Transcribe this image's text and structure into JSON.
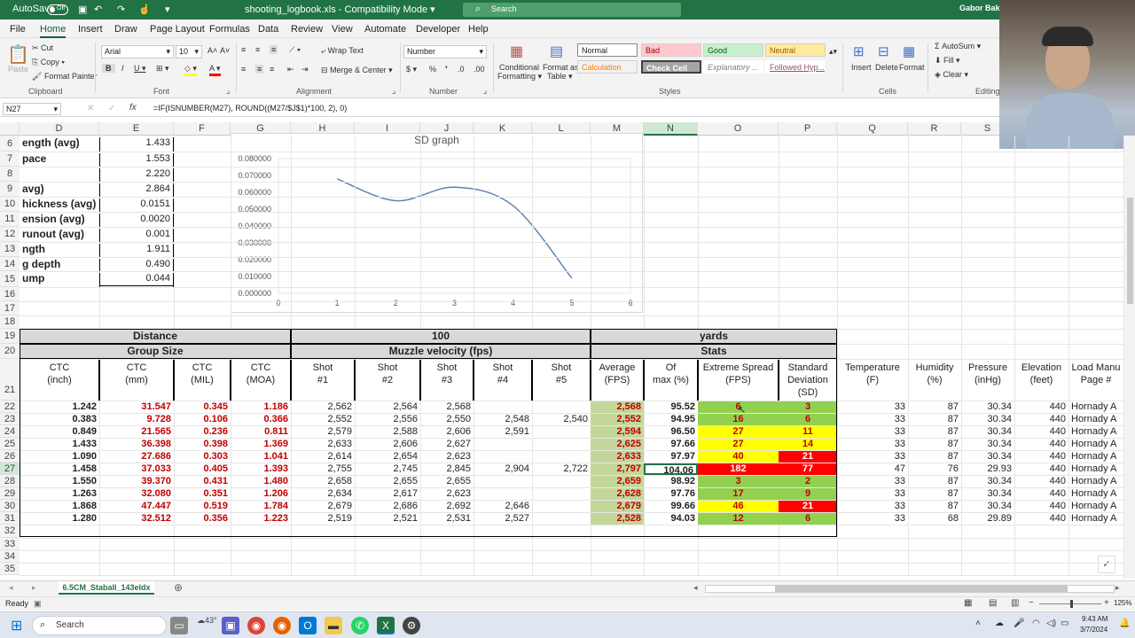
{
  "title": {
    "autosave": "AutoSave",
    "autosave_state": "Off",
    "filename": "shooting_logbook.xls",
    "mode": "Compatibility Mode",
    "search": "Search",
    "user": "Gabor Bakos"
  },
  "menu": [
    "File",
    "Home",
    "Insert",
    "Draw",
    "Page Layout",
    "Formulas",
    "Data",
    "Review",
    "View",
    "Automate",
    "Developer",
    "Help"
  ],
  "ribbon": {
    "cut": "Cut",
    "copy": "Copy",
    "format_painter": "Format Painter",
    "paste": "Paste",
    "clipboard": "Clipboard",
    "font_name": "Arial",
    "font_size": "10",
    "font": "Font",
    "wrap_text": "Wrap Text",
    "merge_center": "Merge & Center",
    "alignment": "Alignment",
    "number_format": "Number",
    "number": "Number",
    "conditional": "Conditional",
    "formatting": "Formatting",
    "format_as": "Format as",
    "table": "Table",
    "styles_label": "Styles",
    "styles": {
      "normal": "Normal",
      "bad": "Bad",
      "good": "Good",
      "neutral": "Neutral",
      "calculation": "Calculation",
      "check_cell": "Check Cell",
      "explanatory": "Explanatory ...",
      "followed": "Followed Hyp..."
    },
    "insert": "Insert",
    "delete": "Delete",
    "format": "Format",
    "cells": "Cells",
    "autosum": "AutoSum",
    "fill": "Fill",
    "clear": "Clear",
    "editing": "Editing"
  },
  "formula": {
    "namebox": "N27",
    "fx": "fx",
    "text": "=IF(ISNUMBER(M27), ROUND((M27/$J$1)*100, 2), 0)"
  },
  "columns": [
    "D",
    "E",
    "F",
    "G",
    "H",
    "I",
    "J",
    "K",
    "L",
    "M",
    "N",
    "O",
    "P",
    "Q",
    "R",
    "S"
  ],
  "rows": [
    "6",
    "7",
    "8",
    "9",
    "10",
    "11",
    "12",
    "13",
    "14",
    "15",
    "16",
    "17",
    "18",
    "19",
    "20",
    "21",
    "22",
    "23",
    "24",
    "25",
    "26",
    "27",
    "28",
    "29",
    "30",
    "31",
    "32",
    "33",
    "34",
    "35"
  ],
  "top_table": [
    {
      "label": "ength (avg)",
      "value": "1.433"
    },
    {
      "label": "pace",
      "value": "1.553"
    },
    {
      "label": "",
      "value": "2.220"
    },
    {
      "label": "avg)",
      "value": "2.864"
    },
    {
      "label": "hickness (avg)",
      "value": "0.0151"
    },
    {
      "label": "ension (avg)",
      "value": "0.0020"
    },
    {
      "label": "runout (avg)",
      "value": "0.001"
    },
    {
      "label": "ngth",
      "value": "1.911"
    },
    {
      "label": "g depth",
      "value": "0.490"
    },
    {
      "label": "ump",
      "value": "0.044"
    }
  ],
  "chart_data": {
    "type": "line",
    "title": "SD graph",
    "x": [
      1,
      2,
      3,
      4,
      5
    ],
    "values": [
      0.068,
      0.055,
      0.063,
      0.052,
      0.009
    ],
    "xlim": [
      0,
      6
    ],
    "ylim": [
      0,
      0.08
    ],
    "xticks": [
      "0",
      "1",
      "2",
      "3",
      "4",
      "5",
      "6"
    ],
    "yticks": [
      "0.000000",
      "0.010000",
      "0.020000",
      "0.030000",
      "0.040000",
      "0.050000",
      "0.060000",
      "0.070000",
      "0.080000"
    ],
    "color": "#5b84b1"
  },
  "headers": {
    "distance": "Distance",
    "hundred": "100",
    "yards": "yards",
    "group_size": "Group Size",
    "muzzle": "Muzzle velocity (fps)",
    "stats": "Stats",
    "cols": [
      [
        "CTC",
        "(inch)"
      ],
      [
        "CTC",
        "(mm)"
      ],
      [
        "CTC",
        "(MIL)"
      ],
      [
        "CTC",
        "(MOA)"
      ],
      [
        "Shot",
        "#1"
      ],
      [
        "Shot",
        "#2"
      ],
      [
        "Shot",
        "#3"
      ],
      [
        "Shot",
        "#4"
      ],
      [
        "Shot",
        "#5"
      ],
      [
        "Average",
        "(FPS)"
      ],
      [
        "Of",
        "max (%)"
      ],
      [
        "Extreme Spread",
        "(FPS)"
      ],
      [
        "Standard",
        "Deviation",
        "(SD)"
      ],
      [
        "Temperature",
        "(F)"
      ],
      [
        "Humidity",
        "(%)"
      ],
      [
        "Pressure",
        "(inHg)"
      ],
      [
        "Elevation",
        "(feet)"
      ],
      [
        "Load Manu",
        "Page #"
      ]
    ]
  },
  "data": [
    [
      "1.242",
      "31.547",
      "0.345",
      "1.186",
      "2,562",
      "2,564",
      "2,568",
      "",
      "",
      "2,568",
      "95.52",
      "6",
      "3",
      "33",
      "87",
      "30.34",
      "440",
      "Hornady A"
    ],
    [
      "0.383",
      "9.728",
      "0.106",
      "0.366",
      "2,552",
      "2,556",
      "2,550",
      "2,548",
      "2,540",
      "2,552",
      "94.95",
      "16",
      "6",
      "33",
      "87",
      "30.34",
      "440",
      "Hornady A"
    ],
    [
      "0.849",
      "21.565",
      "0.236",
      "0.811",
      "2,579",
      "2,588",
      "2,606",
      "2,591",
      "",
      "2,594",
      "96.50",
      "27",
      "11",
      "33",
      "87",
      "30.34",
      "440",
      "Hornady A"
    ],
    [
      "1.433",
      "36.398",
      "0.398",
      "1.369",
      "2,633",
      "2,606",
      "2,627",
      "",
      "",
      "2,625",
      "97.66",
      "27",
      "14",
      "33",
      "87",
      "30.34",
      "440",
      "Hornady A"
    ],
    [
      "1.090",
      "27.686",
      "0.303",
      "1.041",
      "2,614",
      "2,654",
      "2,623",
      "",
      "",
      "2,633",
      "97.97",
      "40",
      "21",
      "33",
      "87",
      "30.34",
      "440",
      "Hornady A"
    ],
    [
      "1.458",
      "37.033",
      "0.405",
      "1.393",
      "2,755",
      "2,745",
      "2,845",
      "2,904",
      "2,722",
      "2,797",
      "104.06",
      "182",
      "77",
      "47",
      "76",
      "29.93",
      "440",
      "Hornady A"
    ],
    [
      "1.550",
      "39.370",
      "0.431",
      "1.480",
      "2,658",
      "2,655",
      "2,655",
      "",
      "",
      "2,659",
      "98.92",
      "3",
      "2",
      "33",
      "87",
      "30.34",
      "440",
      "Hornady A"
    ],
    [
      "1.263",
      "32.080",
      "0.351",
      "1.206",
      "2,634",
      "2,617",
      "2,623",
      "",
      "",
      "2,628",
      "97.76",
      "17",
      "9",
      "33",
      "87",
      "30.34",
      "440",
      "Hornady A"
    ],
    [
      "1.868",
      "47.447",
      "0.519",
      "1.784",
      "2,679",
      "2,686",
      "2,692",
      "2,646",
      "",
      "2,679",
      "99.66",
      "46",
      "21",
      "33",
      "87",
      "30.34",
      "440",
      "Hornady A"
    ],
    [
      "1.280",
      "32.512",
      "0.356",
      "1.223",
      "2,519",
      "2,521",
      "2,531",
      "2,527",
      "",
      "2,528",
      "94.03",
      "12",
      "6",
      "33",
      "68",
      "29.89",
      "440",
      "Hornady A"
    ]
  ],
  "es_fill": [
    "g",
    "g",
    "y",
    "y",
    "y",
    "r",
    "g",
    "g",
    "y",
    "g"
  ],
  "sd_fill": [
    "g",
    "g",
    "y",
    "y",
    "r",
    "r",
    "g",
    "g",
    "r",
    "g"
  ],
  "sheet_tab": "6.5CM_Staball_143eldx",
  "status": {
    "ready": "Ready",
    "zoom": "125%"
  },
  "taskbar": {
    "search": "Search",
    "time": "9:43 AM",
    "date": "3/7/2024",
    "temp": "43°"
  }
}
